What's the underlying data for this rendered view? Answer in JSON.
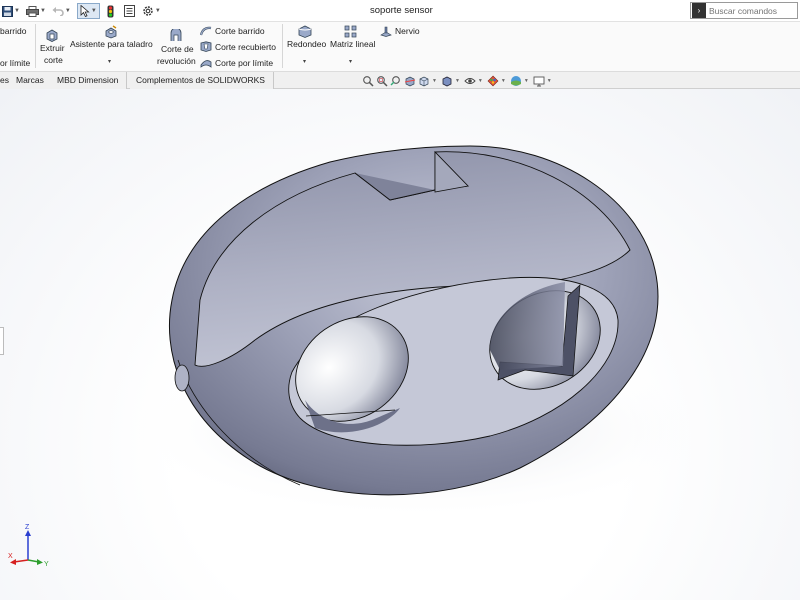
{
  "window": {
    "doc_title": "soporte sensor"
  },
  "search": {
    "placeholder": "Buscar comandos"
  },
  "qat": {
    "icons": [
      "save-icon",
      "print-icon",
      "undo-icon",
      "select-arrow-icon",
      "traffic-light-icon",
      "file-properties-icon",
      "options-gear-icon"
    ]
  },
  "ribbon": {
    "left_partial_top": "barrido",
    "left_partial_bottom": "or límite",
    "extruir_corte": {
      "line1": "Extruir",
      "line2": "corte"
    },
    "asistente_taladro": "Asistente para taladro",
    "corte_revolucion": {
      "line1": "Corte de",
      "line2": "revolución"
    },
    "corte_barrido": "Corte barrido",
    "corte_recubierto": "Corte recubierto",
    "corte_por_limite": "Corte por límite",
    "redondeo": "Redondeo",
    "matriz_lineal": "Matriz lineal",
    "nervio": "Nervio"
  },
  "tabs": [
    {
      "label": "es"
    },
    {
      "label": "Marcas"
    },
    {
      "label": "MBD Dimension"
    },
    {
      "label": "Complementos de SOLIDWORKS"
    }
  ],
  "viewbar": {
    "icons": [
      "zoom-to-fit-icon",
      "zoom-area-icon",
      "previous-view-icon",
      "section-view-icon",
      "view-orientation-icon",
      "display-style-icon",
      "hide-show-items-icon",
      "edit-appearance-icon",
      "apply-scene-icon",
      "view-settings-icon"
    ]
  },
  "triad": {
    "x": "X",
    "y": "Y",
    "z": "Z"
  },
  "colors": {
    "part_base": "#8f93a8",
    "part_highlight": "#c7cad8",
    "part_shadow": "#5e6278",
    "edge": "#1a1a1a",
    "axis_x": "#d62020",
    "axis_y": "#2e9e2e",
    "axis_z": "#2a3fd0"
  }
}
